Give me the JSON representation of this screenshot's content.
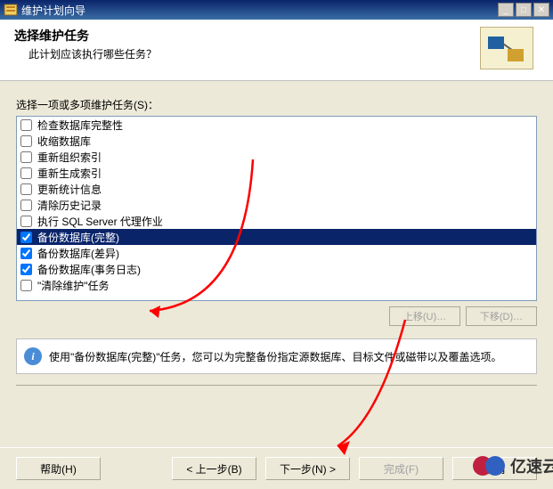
{
  "titlebar": {
    "title": "维护计划向导"
  },
  "header": {
    "title": "选择维护任务",
    "subtitle": "此计划应该执行哪些任务？"
  },
  "prompt": "选择一项或多项维护任务(S)：",
  "tasks": [
    {
      "label": "检查数据库完整性",
      "checked": false,
      "selected": false
    },
    {
      "label": "收缩数据库",
      "checked": false,
      "selected": false
    },
    {
      "label": "重新组织索引",
      "checked": false,
      "selected": false
    },
    {
      "label": "重新生成索引",
      "checked": false,
      "selected": false
    },
    {
      "label": "更新统计信息",
      "checked": false,
      "selected": false
    },
    {
      "label": "清除历史记录",
      "checked": false,
      "selected": false
    },
    {
      "label": "执行 SQL Server 代理作业",
      "checked": false,
      "selected": false
    },
    {
      "label": "备份数据库(完整)",
      "checked": true,
      "selected": true
    },
    {
      "label": "备份数据库(差异)",
      "checked": true,
      "selected": false
    },
    {
      "label": "备份数据库(事务日志)",
      "checked": true,
      "selected": false
    },
    {
      "label": "\"清除维护\"任务",
      "checked": false,
      "selected": false
    }
  ],
  "movebtns": {
    "up": "上移(U)…",
    "down": "下移(D)…"
  },
  "hint": "使用\"备份数据库(完整)\"任务，您可以为完整备份指定源数据库、目标文件或磁带以及覆盖选项。",
  "footer": {
    "help": "帮助(H)",
    "back": "< 上一步(B)",
    "next": "下一步(N) >",
    "finish": "完成(F)",
    "cancel": "取消"
  },
  "watermark": {
    "text": "亿速云"
  }
}
